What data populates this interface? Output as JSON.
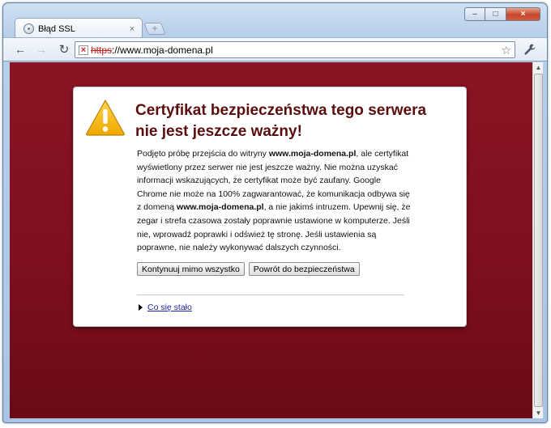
{
  "tab": {
    "title": "Błąd SSL",
    "close": "×",
    "new_tab": "+"
  },
  "window": {
    "minimize": "–",
    "maximize": "□",
    "close": "×"
  },
  "toolbar": {
    "back": "←",
    "forward": "→",
    "reload": "↻",
    "url_scheme": "https",
    "url_rest": "://www.moja-domena.pl",
    "star": "☆",
    "wrench": "🔧"
  },
  "page": {
    "title": "Certyfikat bezpieczeństwa tego serwera nie jest jeszcze ważny!",
    "body": [
      {
        "text": "Podjęto próbę przejścia do witryny ",
        "bold": false
      },
      {
        "text": "www.moja-domena.pl",
        "bold": true
      },
      {
        "text": ", ale certyfikat wyświetlony przez serwer nie jest jeszcze ważny. Nie można uzyskać informacji wskazujących, że certyfikat może być zaufany. Google Chrome nie może na 100% zagwarantować, że komunikacja odbywa się z domeną ",
        "bold": false
      },
      {
        "text": "www.moja-domena.pl",
        "bold": true
      },
      {
        "text": ", a nie jakimś intruzem. Upewnij się, że zegar i strefa czasowa zostały poprawnie ustawione w komputerze. Jeśli nie, wprowadź poprawki i odśwież tę stronę. Jeśli ustawienia są poprawne, nie należy wykonywać dalszych czynności.",
        "bold": false
      }
    ],
    "proceed_button": "Kontynuuj mimo wszystko",
    "back_button": "Powrót do bezpieczeństwa",
    "details_link": "Co się stało"
  },
  "colors": {
    "background": "#7f0f1f",
    "title": "#5b0e0e",
    "link": "#1c27a6",
    "warning": "#f2b400"
  }
}
